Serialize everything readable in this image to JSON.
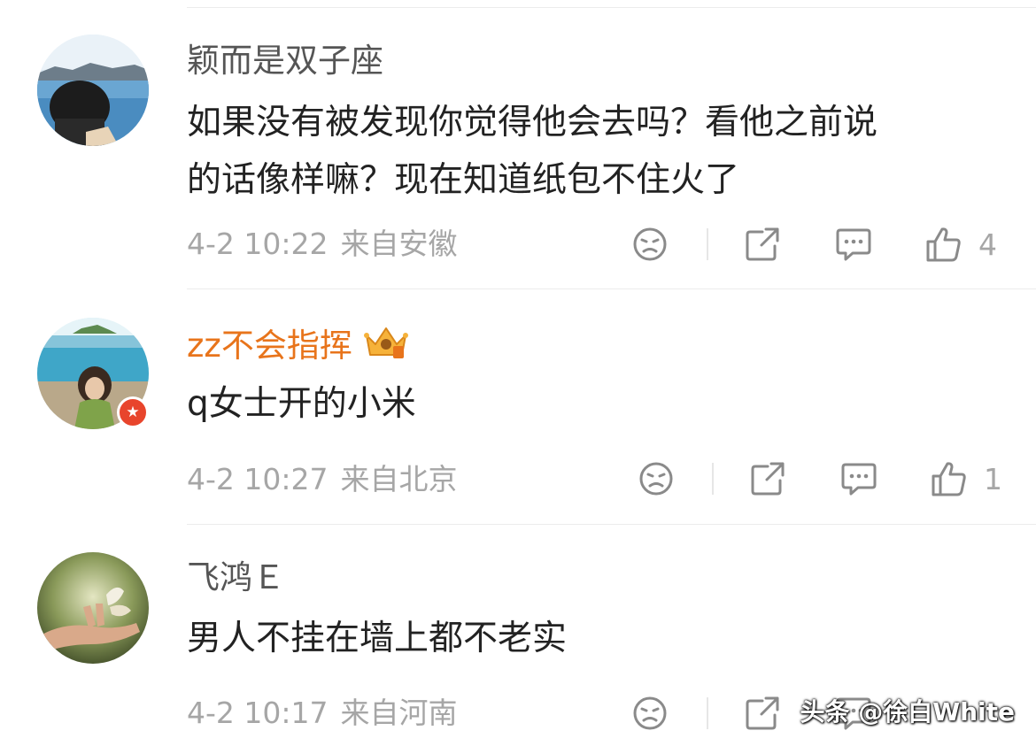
{
  "comments": [
    {
      "username": "颖而是双子座",
      "content_lines": [
        "如果没有被发现你觉得他会去吗？看他之前说",
        "的话像样嘛？现在知道纸包不住火了"
      ],
      "time": "4-2 10:22",
      "location": "来自安徽",
      "likes": "4"
    },
    {
      "username": "zz不会指挥",
      "content_lines": [
        "q女士开的小米"
      ],
      "time": "4-2 10:27",
      "location": "来自北京",
      "likes": "1"
    },
    {
      "username": "飞鸿Ｅ",
      "content_lines": [
        "男人不挂在墙上都不老实"
      ],
      "time": "4-2 10:17",
      "location": "来自河南",
      "likes": ""
    }
  ],
  "watermark": "头条 @徐白White",
  "colors": {
    "vip_username": "#e8741b",
    "badge": "#e8452c",
    "meta_text": "#a6a6a6",
    "icon": "#8a8a8a"
  },
  "icons": [
    "dislike-face-icon",
    "repost-icon",
    "comment-bubble-icon",
    "thumbs-up-icon",
    "crown-badge-icon",
    "star-badge-icon"
  ]
}
